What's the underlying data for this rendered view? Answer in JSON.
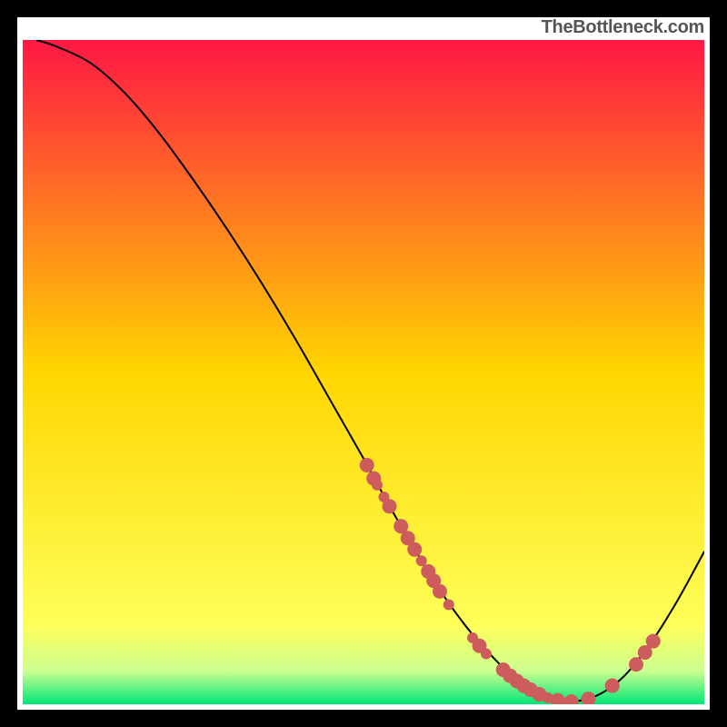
{
  "attribution": "TheBottleneck.com",
  "chart_data": {
    "type": "line",
    "title": "",
    "xlabel": "",
    "ylabel": "",
    "xlim": [
      0,
      100
    ],
    "ylim": [
      0,
      100
    ],
    "grid": false,
    "legend": false,
    "gradient_stops": [
      {
        "offset": 0,
        "color": "#ff1744"
      },
      {
        "offset": 0.5,
        "color": "#ffd600"
      },
      {
        "offset": 0.88,
        "color": "#ffff59"
      },
      {
        "offset": 0.95,
        "color": "#ccff90"
      },
      {
        "offset": 1.0,
        "color": "#00e676"
      }
    ],
    "series": [
      {
        "name": "curve",
        "type": "line",
        "color": "#000000",
        "x": [
          2,
          5,
          10,
          15,
          20,
          25,
          30,
          35,
          40,
          45,
          50,
          54,
          58,
          62,
          66,
          70,
          73,
          76,
          80,
          84,
          88,
          92,
          96,
          100
        ],
        "y": [
          100,
          99,
          96.5,
          92,
          86,
          79,
          71.5,
          63.5,
          55,
          46,
          37,
          29.5,
          22.5,
          16,
          10.5,
          6,
          3,
          1.2,
          0.4,
          1.2,
          4,
          9,
          15.5,
          23
        ]
      },
      {
        "name": "markers",
        "type": "scatter",
        "color": "#cd5c5c",
        "radius_large": 8,
        "radius_small": 6,
        "points": [
          {
            "x": 50.5,
            "y": 36.0,
            "r": "large"
          },
          {
            "x": 51.5,
            "y": 34.0,
            "r": "large"
          },
          {
            "x": 52.0,
            "y": 33.0,
            "r": "small"
          },
          {
            "x": 53.0,
            "y": 31.2,
            "r": "small"
          },
          {
            "x": 53.8,
            "y": 29.8,
            "r": "large"
          },
          {
            "x": 55.5,
            "y": 26.8,
            "r": "large"
          },
          {
            "x": 56.5,
            "y": 25.0,
            "r": "large"
          },
          {
            "x": 57.5,
            "y": 23.3,
            "r": "large"
          },
          {
            "x": 58.5,
            "y": 21.6,
            "r": "small"
          },
          {
            "x": 59.5,
            "y": 20.0,
            "r": "large"
          },
          {
            "x": 60.3,
            "y": 18.6,
            "r": "large"
          },
          {
            "x": 61.2,
            "y": 17.0,
            "r": "large"
          },
          {
            "x": 62.5,
            "y": 15.0,
            "r": "small"
          },
          {
            "x": 66.0,
            "y": 10.0,
            "r": "small"
          },
          {
            "x": 67.0,
            "y": 8.8,
            "r": "large"
          },
          {
            "x": 68.0,
            "y": 7.6,
            "r": "small"
          },
          {
            "x": 70.5,
            "y": 5.2,
            "r": "large"
          },
          {
            "x": 71.5,
            "y": 4.3,
            "r": "large"
          },
          {
            "x": 72.5,
            "y": 3.5,
            "r": "large"
          },
          {
            "x": 73.5,
            "y": 2.8,
            "r": "large"
          },
          {
            "x": 74.5,
            "y": 2.2,
            "r": "large"
          },
          {
            "x": 75.8,
            "y": 1.5,
            "r": "large"
          },
          {
            "x": 77.0,
            "y": 1.0,
            "r": "small"
          },
          {
            "x": 78.5,
            "y": 0.6,
            "r": "large"
          },
          {
            "x": 80.5,
            "y": 0.4,
            "r": "large"
          },
          {
            "x": 83.0,
            "y": 0.8,
            "r": "large"
          },
          {
            "x": 86.5,
            "y": 2.8,
            "r": "large"
          },
          {
            "x": 90.0,
            "y": 6.0,
            "r": "large"
          },
          {
            "x": 91.3,
            "y": 7.8,
            "r": "large"
          },
          {
            "x": 92.5,
            "y": 9.5,
            "r": "large"
          }
        ]
      }
    ]
  }
}
